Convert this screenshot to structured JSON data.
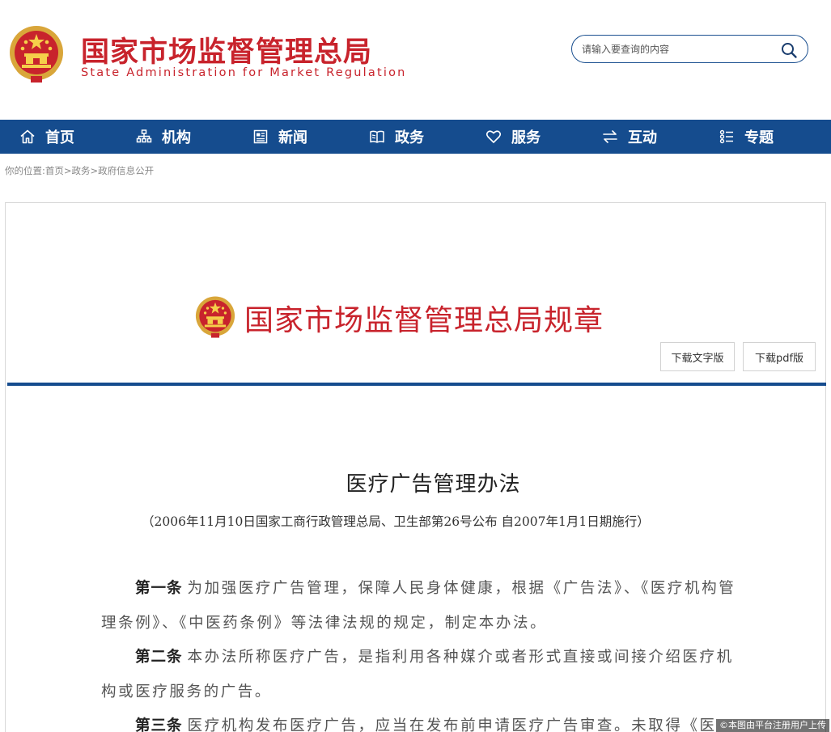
{
  "header": {
    "title_cn": "国家市场监督管理总局",
    "title_en": "State Administration for Market Regulation",
    "emblem_icon": "national-emblem-icon"
  },
  "search": {
    "placeholder": "请输入要查询的内容",
    "icon": "search-icon"
  },
  "nav": {
    "items": [
      {
        "label": "首页",
        "icon": "home-icon"
      },
      {
        "label": "机构",
        "icon": "org-chart-icon"
      },
      {
        "label": "新闻",
        "icon": "news-icon"
      },
      {
        "label": "政务",
        "icon": "book-icon"
      },
      {
        "label": "服务",
        "icon": "heart-icon"
      },
      {
        "label": "互动",
        "icon": "exchange-arrows-icon"
      },
      {
        "label": "专题",
        "icon": "topics-list-icon"
      }
    ]
  },
  "breadcrumb": {
    "prefix": "你的位置:",
    "items": [
      "首页",
      "政务",
      "政府信息公开"
    ],
    "separator": ">"
  },
  "regulation": {
    "banner_title": "国家市场监督管理总局规章",
    "download_text_label": "下载文字版",
    "download_pdf_label": "下载pdf版"
  },
  "document": {
    "title": "医疗广告管理办法",
    "subtitle": "（2006年11月10日国家工商行政管理总局、卫生部第26号公布 自2007年1月1日期施行）",
    "articles": [
      {
        "head": "第一条",
        "text": "为加强医疗广告管理，保障人民身体健康，根据《广告法》、《医疗机构管理条例》、《中医药条例》等法律法规的规定，制定本办法。"
      },
      {
        "head": "第二条",
        "text": "本办法所称医疗广告，是指利用各种媒介或者形式直接或间接介绍医疗机构或医疗服务的广告。"
      },
      {
        "head": "第三条",
        "text": "医疗机构发布医疗广告，应当在发布前申请医疗广告审查。未取得《医"
      }
    ]
  },
  "watermark": "©本图由平台注册用户上传",
  "colors": {
    "brand_red": "#c8232c",
    "nav_blue": "#154c8e"
  }
}
